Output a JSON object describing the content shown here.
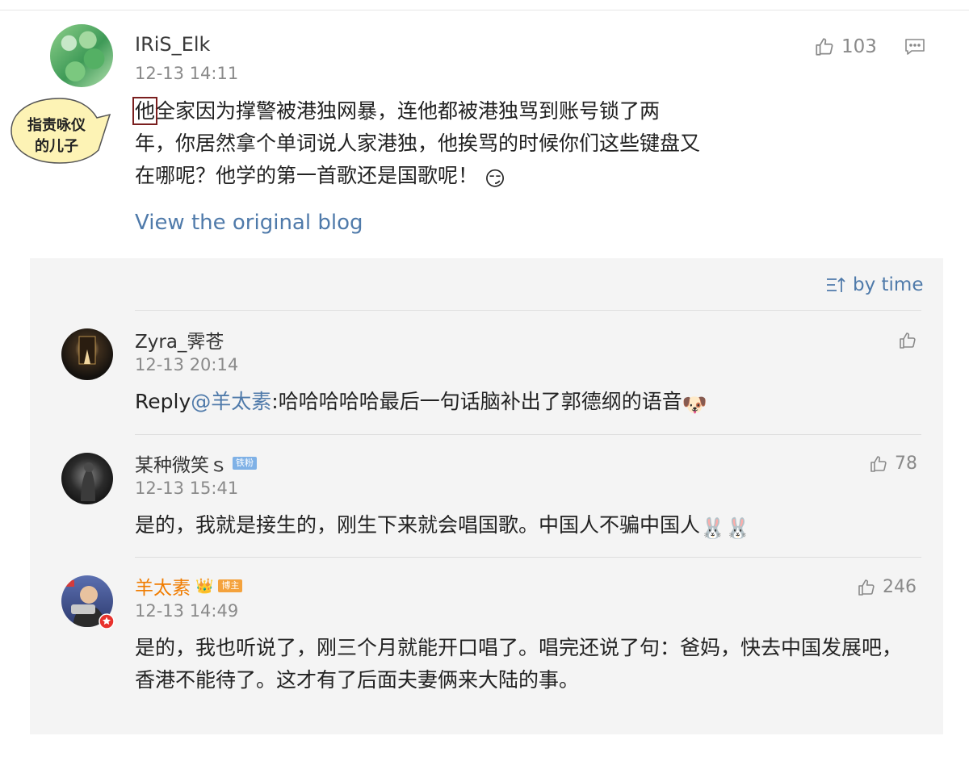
{
  "main_comment": {
    "username": "IRiS_Elk",
    "time": "12-13 14:11",
    "likes": "103",
    "text_highlight": "他",
    "text": "全家因为撑警被港独网暴，连他都被港独骂到账号锁了两年，你居然拿个单词说人家港独，他挨骂的时候你们这些键盘又在哪呢？他学的第一首歌还是国歌呢！",
    "emoji": "😏",
    "view_original": "View the original blog"
  },
  "annotation": {
    "line1": "指责咏仪",
    "line2": "的儿子"
  },
  "replies_header": {
    "sort_label": "by time"
  },
  "replies": [
    {
      "username": "Zyra_霁苍",
      "time": "12-13 20:14",
      "likes": "",
      "reply_prefix": "Reply",
      "mention": "@羊太素",
      "text": ":哈哈哈哈哈最后一句话脑补出了郭德纲的语音",
      "emoji": "🐶"
    },
    {
      "username": "某种微笑ｓ",
      "badge": "铁粉",
      "time": "12-13 15:41",
      "likes": "78",
      "text": "是的，我就是接生的，刚生下来就会唱国歌。中国人不骗中国人",
      "emoji": "🐰🐰"
    },
    {
      "username": "羊太素",
      "badge_crown": "👑",
      "badge": "博主",
      "time": "12-13 14:49",
      "likes": "246",
      "text": "是的，我也听说了，刚三个月就能开口唱了。唱完还说了句：爸妈，快去中国发展吧，香港不能待了。这才有了后面夫妻俩来大陆的事。"
    }
  ],
  "colors": {
    "link": "#4f7aaa",
    "host_name": "#f07c00",
    "highlight_box": "#7a1f1f",
    "bubble_fill": "#fdf3b5"
  }
}
